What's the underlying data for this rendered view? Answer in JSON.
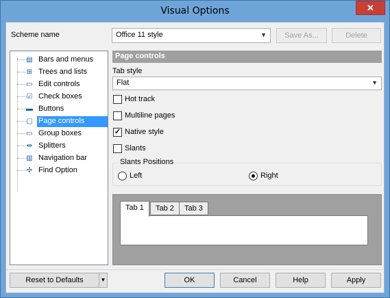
{
  "window": {
    "title": "Visual Options",
    "close_glyph": "✕"
  },
  "scheme": {
    "label": "Scheme name",
    "selected": "Office 11 style",
    "save_as": "Save As...",
    "delete": "Delete"
  },
  "tree": {
    "items": [
      {
        "label": "Bars and menus",
        "icon": "bars-menus-icon",
        "glyph": "▤"
      },
      {
        "label": "Trees and lists",
        "icon": "tree-list-icon",
        "glyph": "⊞"
      },
      {
        "label": "Edit controls",
        "icon": "edit-control-icon",
        "glyph": "▭"
      },
      {
        "label": "Check boxes",
        "icon": "checkbox-icon",
        "glyph": "☑"
      },
      {
        "label": "Buttons",
        "icon": "button-icon",
        "glyph": "▬"
      },
      {
        "label": "Page controls",
        "icon": "page-control-icon",
        "glyph": "▢"
      },
      {
        "label": "Group boxes",
        "icon": "group-box-icon",
        "glyph": "▭"
      },
      {
        "label": "Splitters",
        "icon": "splitter-icon",
        "glyph": "⇹"
      },
      {
        "label": "Navigation bar",
        "icon": "navigation-bar-icon",
        "glyph": "▥"
      },
      {
        "label": "Find Option",
        "icon": "find-option-icon",
        "glyph": "✣"
      }
    ],
    "selected": "Page controls"
  },
  "panel": {
    "header": "Page controls",
    "tab_style_label": "Tab style",
    "tab_style_value": "Flat",
    "options": [
      {
        "label": "Hot track",
        "checked": false
      },
      {
        "label": "Multiline pages",
        "checked": false
      },
      {
        "label": "Native style",
        "checked": true
      },
      {
        "label": "Slants",
        "checked": false
      }
    ],
    "slants_title": "Slants Positions",
    "slants": [
      {
        "label": "Left",
        "selected": false
      },
      {
        "label": "Right",
        "selected": true
      }
    ],
    "preview_tabs": [
      "Tab 1",
      "Tab 2",
      "Tab 3"
    ]
  },
  "footer": {
    "reset": "Reset to Defaults",
    "ok": "OK",
    "cancel": "Cancel",
    "help": "Help",
    "apply": "Apply"
  },
  "colors": {
    "title_bar": "#6fa4d8",
    "selection": "#3399ff",
    "close_button": "#c74036",
    "panel_header": "#a0a0a0"
  }
}
